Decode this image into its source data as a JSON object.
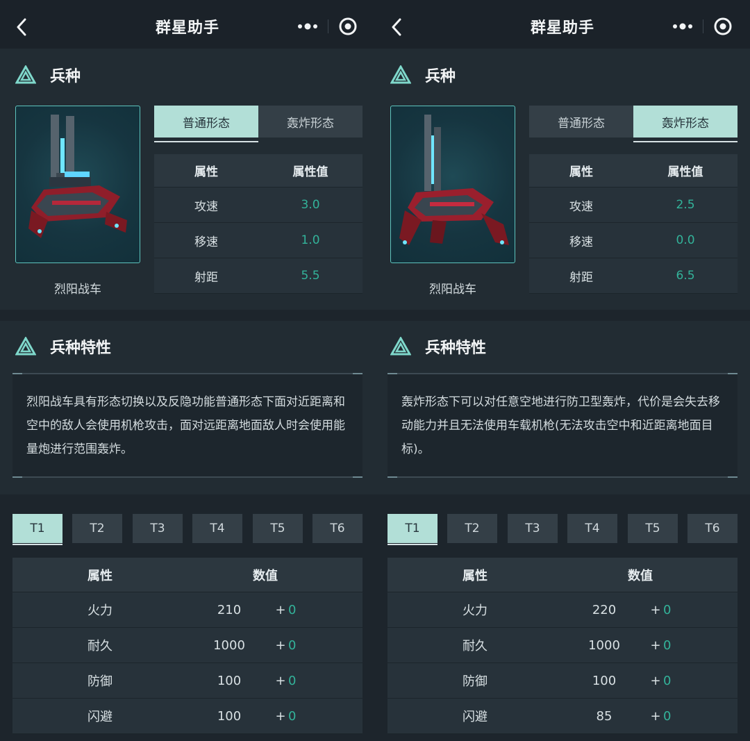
{
  "app": {
    "title": "群星助手"
  },
  "colors": {
    "accent": "#b2dfd7",
    "value_green": "#33b39a",
    "background": "#1d252c"
  },
  "panels": [
    {
      "section_unit": "兵种",
      "unit_name": "烈阳战车",
      "mode_tabs": [
        "普通形态",
        "轰炸形态"
      ],
      "active_mode": 0,
      "attr_headers": [
        "属性",
        "属性值"
      ],
      "attrs": [
        {
          "name": "攻速",
          "value": "3.0"
        },
        {
          "name": "移速",
          "value": "1.0"
        },
        {
          "name": "射距",
          "value": "5.5"
        }
      ],
      "section_traits": "兵种特性",
      "description": "烈阳战车具有形态切换以及反隐功能普通形态下面对近距离和空中的敌人会使用机枪攻击，面对远距离地面敌人时会使用能量炮进行范围轰炸。",
      "tiers": [
        "T1",
        "T2",
        "T3",
        "T4",
        "T5",
        "T6"
      ],
      "active_tier": 0,
      "stat_headers": [
        "属性",
        "数值"
      ],
      "stats": [
        {
          "name": "火力",
          "value": "210",
          "plus": "+",
          "bonus": "0"
        },
        {
          "name": "耐久",
          "value": "1000",
          "plus": "+",
          "bonus": "0"
        },
        {
          "name": "防御",
          "value": "100",
          "plus": "+",
          "bonus": "0"
        },
        {
          "name": "闪避",
          "value": "100",
          "plus": "+",
          "bonus": "0"
        }
      ]
    },
    {
      "section_unit": "兵种",
      "unit_name": "烈阳战车",
      "mode_tabs": [
        "普通形态",
        "轰炸形态"
      ],
      "active_mode": 1,
      "attr_headers": [
        "属性",
        "属性值"
      ],
      "attrs": [
        {
          "name": "攻速",
          "value": "2.5"
        },
        {
          "name": "移速",
          "value": "0.0"
        },
        {
          "name": "射距",
          "value": "6.5"
        }
      ],
      "section_traits": "兵种特性",
      "description": "轰炸形态下可以对任意空地进行防卫型轰炸，代价是会失去移动能力并且无法使用车载机枪(无法攻击空中和近距离地面目标)。",
      "tiers": [
        "T1",
        "T2",
        "T3",
        "T4",
        "T5",
        "T6"
      ],
      "active_tier": 0,
      "stat_headers": [
        "属性",
        "数值"
      ],
      "stats": [
        {
          "name": "火力",
          "value": "220",
          "plus": "+",
          "bonus": "0"
        },
        {
          "name": "耐久",
          "value": "1000",
          "plus": "+",
          "bonus": "0"
        },
        {
          "name": "防御",
          "value": "100",
          "plus": "+",
          "bonus": "0"
        },
        {
          "name": "闪避",
          "value": "85",
          "plus": "+",
          "bonus": "0"
        }
      ]
    }
  ]
}
